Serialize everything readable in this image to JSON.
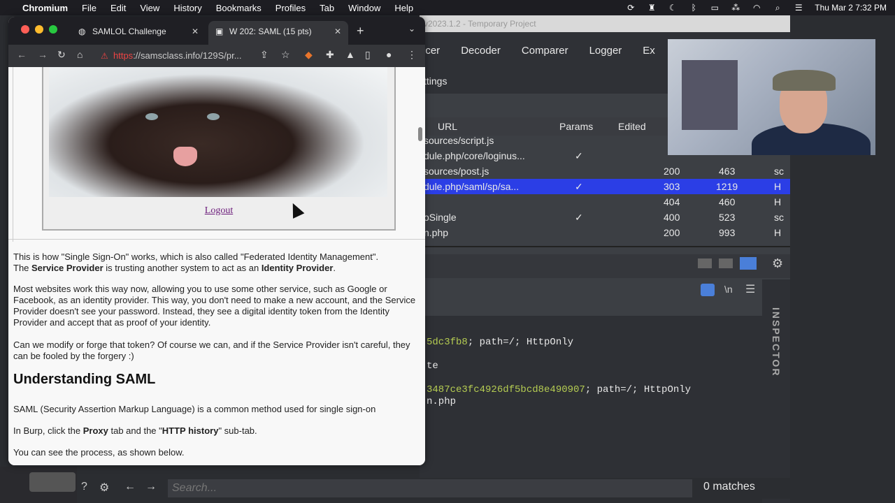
{
  "menubar": {
    "app": "Chromium",
    "items": [
      "File",
      "Edit",
      "View",
      "History",
      "Bookmarks",
      "Profiles",
      "Tab",
      "Window",
      "Help"
    ],
    "clock": "Thu Mar 2  7:32 PM"
  },
  "burp": {
    "title": "v2023.1.2 - Temporary Project",
    "tabs": [
      "ncer",
      "Decoder",
      "Comparer",
      "Logger",
      "Ex"
    ],
    "subtab": "ttings",
    "history_headers": {
      "url": "URL",
      "params": "Params",
      "edited": "Edited"
    },
    "history_rows": [
      {
        "url": "sources/script.js",
        "params": "",
        "status": "",
        "length": "",
        "mime": ""
      },
      {
        "url": "dule.php/core/loginus...",
        "params": "✓",
        "status": "",
        "length": "",
        "mime": ""
      },
      {
        "url": "sources/post.js",
        "params": "",
        "status": "200",
        "length": "463",
        "mime": "sc"
      },
      {
        "url": "dule.php/saml/sp/sa...",
        "params": "✓",
        "status": "303",
        "length": "1219",
        "mime": "H"
      },
      {
        "url": "",
        "params": "",
        "status": "404",
        "length": "460",
        "mime": "H"
      },
      {
        "url": "oSingle",
        "params": "✓",
        "status": "400",
        "length": "523",
        "mime": "sc"
      },
      {
        "url": "n.php",
        "params": "",
        "status": "200",
        "length": "993",
        "mime": "H"
      }
    ],
    "editor_lines": [
      {
        "green": "5dc3fb8",
        "white": "; path=/; HttpOnly"
      },
      {
        "green": "",
        "white": "te"
      },
      {
        "green": "3487ce3fc4926df5bcd8e490907",
        "white": "; path=/; HttpOnly"
      },
      {
        "green": "",
        "white": "n.php"
      }
    ],
    "inspector_label": "INSPECTOR",
    "newline_label": "\\n"
  },
  "search": {
    "placeholder": "Search...",
    "matches": "0 matches"
  },
  "chrome": {
    "tabs": [
      {
        "label": "SAMLOL Challenge"
      },
      {
        "label": "W 202: SAML (15 pts)"
      }
    ],
    "url_https": "https",
    "url_rest": "://samsclass.info/129S/pr..."
  },
  "page": {
    "logout": "Logout",
    "p1_a": "This is how \"Single Sign-On\" works, which is also called \"Federated Identity Management\".",
    "p1_b_pre": "The ",
    "p1_b_sp": "Service Provider",
    "p1_b_mid": " is trusting another system to act as an ",
    "p1_b_idp": "Identity Provider",
    "p1_b_end": ".",
    "p2": "Most websites work this way now, allowing you to use some other service, such as Google or Facebook, as an identity provider. This way, you don't need to make a new account, and the Service Provider doesn't see your password. Instead, they see a digital identity token from the Identity Provider and accept that as proof of your identity.",
    "p3": "Can we modify or forge that token? Of course we can, and if the Service Provider isn't careful, they can be fooled by the forgery :)",
    "h2": "Understanding SAML",
    "p4": "SAML (Security Assertion Markup Language) is a common method used for single sign-on",
    "p5_pre": "In Burp, click the ",
    "p5_proxy": "Proxy",
    "p5_mid": " tab and the \"",
    "p5_http": "HTTP history",
    "p5_end": "\" sub-tab.",
    "p6": "You can see the process, as shown below."
  }
}
